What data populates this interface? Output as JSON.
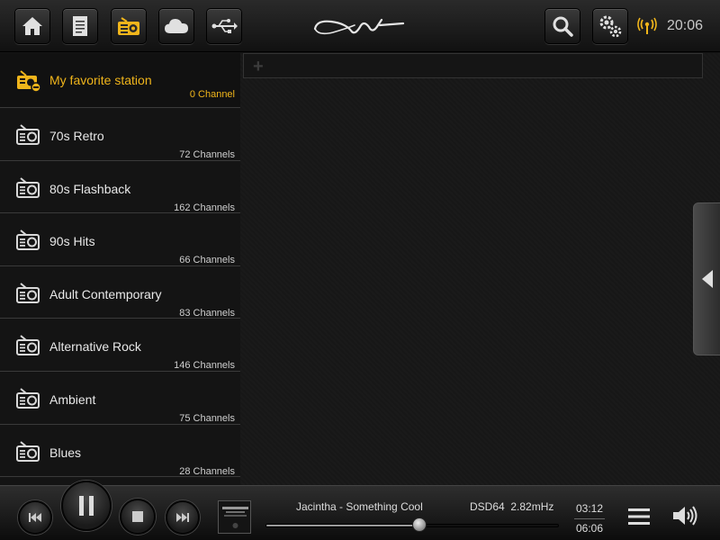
{
  "header": {
    "icons": [
      "home-icon",
      "document-icon",
      "radio-icon",
      "cloud-icon",
      "usb-icon",
      "search-icon",
      "gear-icon",
      "wifi-icon"
    ],
    "active": "radio-icon",
    "accent": "#f0b51b",
    "time": "20:06"
  },
  "sidebar": {
    "items": [
      {
        "label": "My favorite station",
        "count": "0 Channel"
      },
      {
        "label": "70s Retro",
        "count": "72 Channels"
      },
      {
        "label": "80s Flashback",
        "count": "162 Channels"
      },
      {
        "label": "90s Hits",
        "count": "66 Channels"
      },
      {
        "label": "Adult Contemporary",
        "count": "83 Channels"
      },
      {
        "label": "Alternative Rock",
        "count": "146 Channels"
      },
      {
        "label": "Ambient",
        "count": "75 Channels"
      },
      {
        "label": "Blues",
        "count": "28 Channels"
      }
    ]
  },
  "main": {
    "add_symbol": "+"
  },
  "player": {
    "track": "Jacintha - Something Cool",
    "format": "DSD64",
    "rate": "2.82mHz",
    "elapsed": "03:12",
    "duration": "06:06",
    "progress": 0.525
  }
}
